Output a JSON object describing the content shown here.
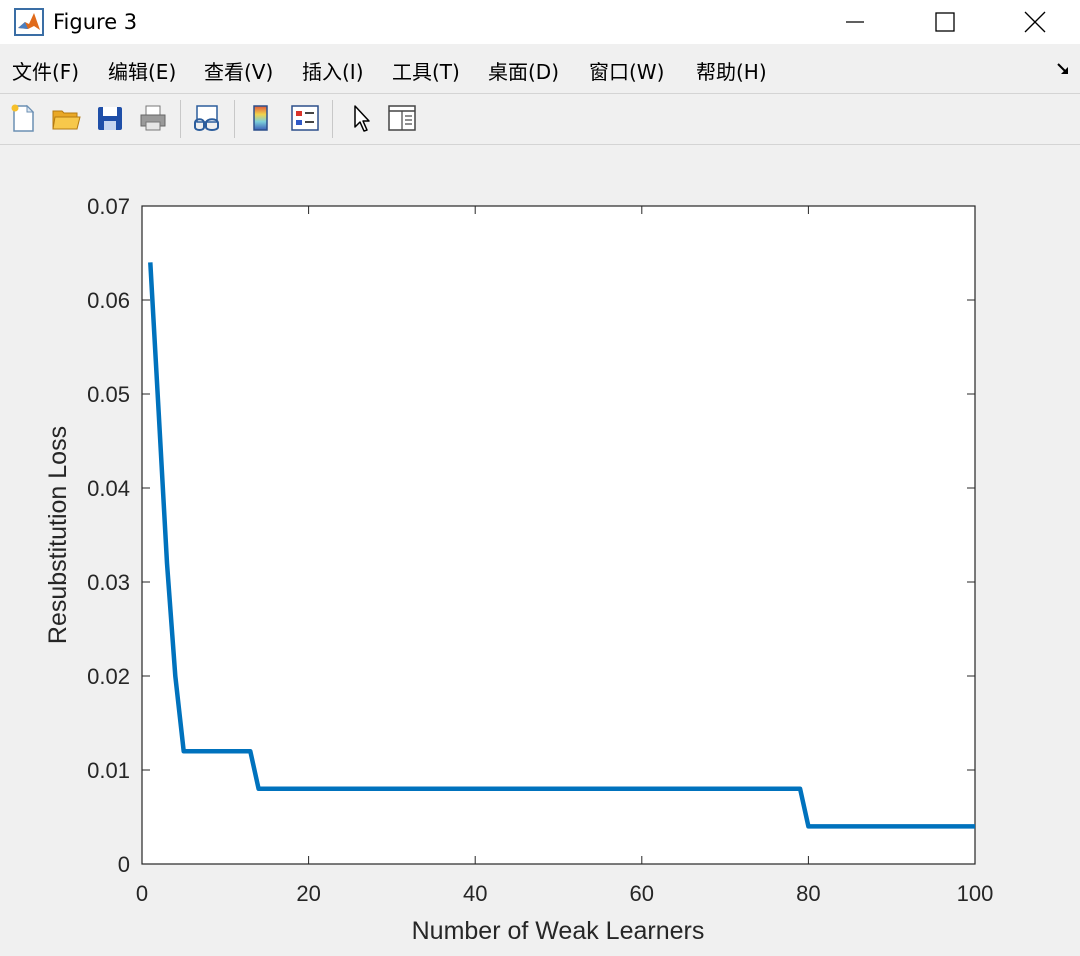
{
  "window": {
    "title": "Figure 3"
  },
  "menu": {
    "items": [
      {
        "label": "文件(F)"
      },
      {
        "label": "编辑(E)"
      },
      {
        "label": "查看(V)"
      },
      {
        "label": "插入(I)"
      },
      {
        "label": "工具(T)"
      },
      {
        "label": "桌面(D)"
      },
      {
        "label": "窗口(W)"
      },
      {
        "label": "帮助(H)"
      }
    ]
  },
  "toolbar": {
    "icons": [
      "new-file-icon",
      "open-folder-icon",
      "save-icon",
      "print-icon",
      "link-plot-icon",
      "insert-colorbar-icon",
      "insert-legend-icon",
      "edit-plot-icon",
      "property-inspector-icon"
    ]
  },
  "colors": {
    "line": "#0072bd",
    "axes": "#262626"
  },
  "chart_data": {
    "type": "line",
    "xlabel": "Number of Weak Learners",
    "ylabel": "Resubstitution Loss",
    "xlim": [
      0,
      100
    ],
    "ylim": [
      0,
      0.07
    ],
    "xticks": [
      0,
      20,
      40,
      60,
      80,
      100
    ],
    "xtick_labels": [
      "0",
      "20",
      "40",
      "60",
      "80",
      "100"
    ],
    "yticks": [
      0,
      0.01,
      0.02,
      0.03,
      0.04,
      0.05,
      0.06,
      0.07
    ],
    "ytick_labels": [
      "0",
      "0.01",
      "0.02",
      "0.03",
      "0.04",
      "0.05",
      "0.06",
      "0.07"
    ],
    "grid": false,
    "series": [
      {
        "x": [
          1,
          2,
          3,
          4,
          5,
          13,
          14,
          79,
          80,
          100
        ],
        "y": [
          0.064,
          0.048,
          0.032,
          0.02,
          0.012,
          0.012,
          0.008,
          0.008,
          0.004,
          0.004
        ]
      }
    ]
  }
}
